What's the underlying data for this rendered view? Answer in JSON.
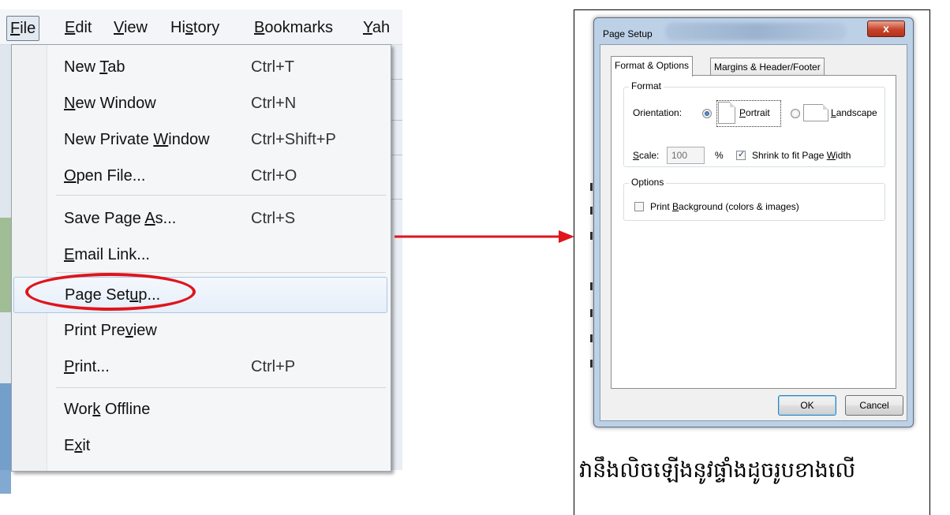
{
  "menubar": {
    "items": [
      {
        "text": "File",
        "ul": "F",
        "rest": "ile"
      },
      {
        "text": "Edit",
        "ul": "E",
        "rest": "dit"
      },
      {
        "text": "View",
        "ul": "V",
        "rest": "iew"
      },
      {
        "text": "History",
        "pre": "Hi",
        "ul": "s",
        "rest": "tory"
      },
      {
        "text": "Bookmarks",
        "ul": "B",
        "rest": "ookmarks"
      },
      {
        "text": "Yaho",
        "ul": "Y",
        "rest": "ah"
      }
    ]
  },
  "file_menu": {
    "items": [
      {
        "pre": "New ",
        "ul": "T",
        "post": "ab",
        "shortcut": "Ctrl+T"
      },
      {
        "pre": "",
        "ul": "N",
        "post": "ew Window",
        "shortcut": "Ctrl+N"
      },
      {
        "pre": "New Private ",
        "ul": "W",
        "post": "indow",
        "shortcut": "Ctrl+Shift+P"
      },
      {
        "pre": "",
        "ul": "O",
        "post": "pen File...",
        "shortcut": "Ctrl+O"
      },
      {
        "pre": "Save Page ",
        "ul": "A",
        "post": "s...",
        "shortcut": "Ctrl+S"
      },
      {
        "pre": "",
        "ul": "E",
        "post": "mail Link...",
        "shortcut": ""
      },
      {
        "pre": "Page Set",
        "ul": "u",
        "post": "p...",
        "shortcut": ""
      },
      {
        "pre": "Print Pre",
        "ul": "v",
        "post": "iew",
        "shortcut": ""
      },
      {
        "pre": "",
        "ul": "P",
        "post": "rint...",
        "shortcut": "Ctrl+P"
      },
      {
        "pre": "Wor",
        "ul": "k",
        "post": " Offline",
        "shortcut": ""
      },
      {
        "pre": "E",
        "ul": "x",
        "post": "it",
        "shortcut": ""
      }
    ],
    "highlighted_item": "Page Setup...",
    "annotation_color": "#e0141b"
  },
  "dialog": {
    "title": "Page Setup",
    "close_glyph": "x",
    "tabs": [
      "Format & Options",
      "Margins & Header/Footer"
    ],
    "active_tab": "Format & Options",
    "format_group": {
      "legend": "Format",
      "orientation_label": "Orientation:",
      "portrait": {
        "ul": "P",
        "rest": "ortrait",
        "selected": true
      },
      "landscape": {
        "ul": "L",
        "rest": "andscape",
        "selected": false
      },
      "scale_label": {
        "ul": "S",
        "rest": "cale:"
      },
      "scale_value": "100",
      "percent": "%",
      "shrink": {
        "pre": "Shrink to fit Page ",
        "ul": "W",
        "post": "idth",
        "checked": true
      }
    },
    "options_group": {
      "legend": "Options",
      "print_background": {
        "pre": "Print ",
        "ul": "B",
        "post": "ackground (colors & images)",
        "checked": false
      }
    },
    "ok_label": "OK",
    "cancel_label": "Cancel"
  },
  "caption": "វានឹងលិចឡើងនូវផ្ទាំងដូចរូបខាងលើ",
  "arrow_color": "#e0141b"
}
